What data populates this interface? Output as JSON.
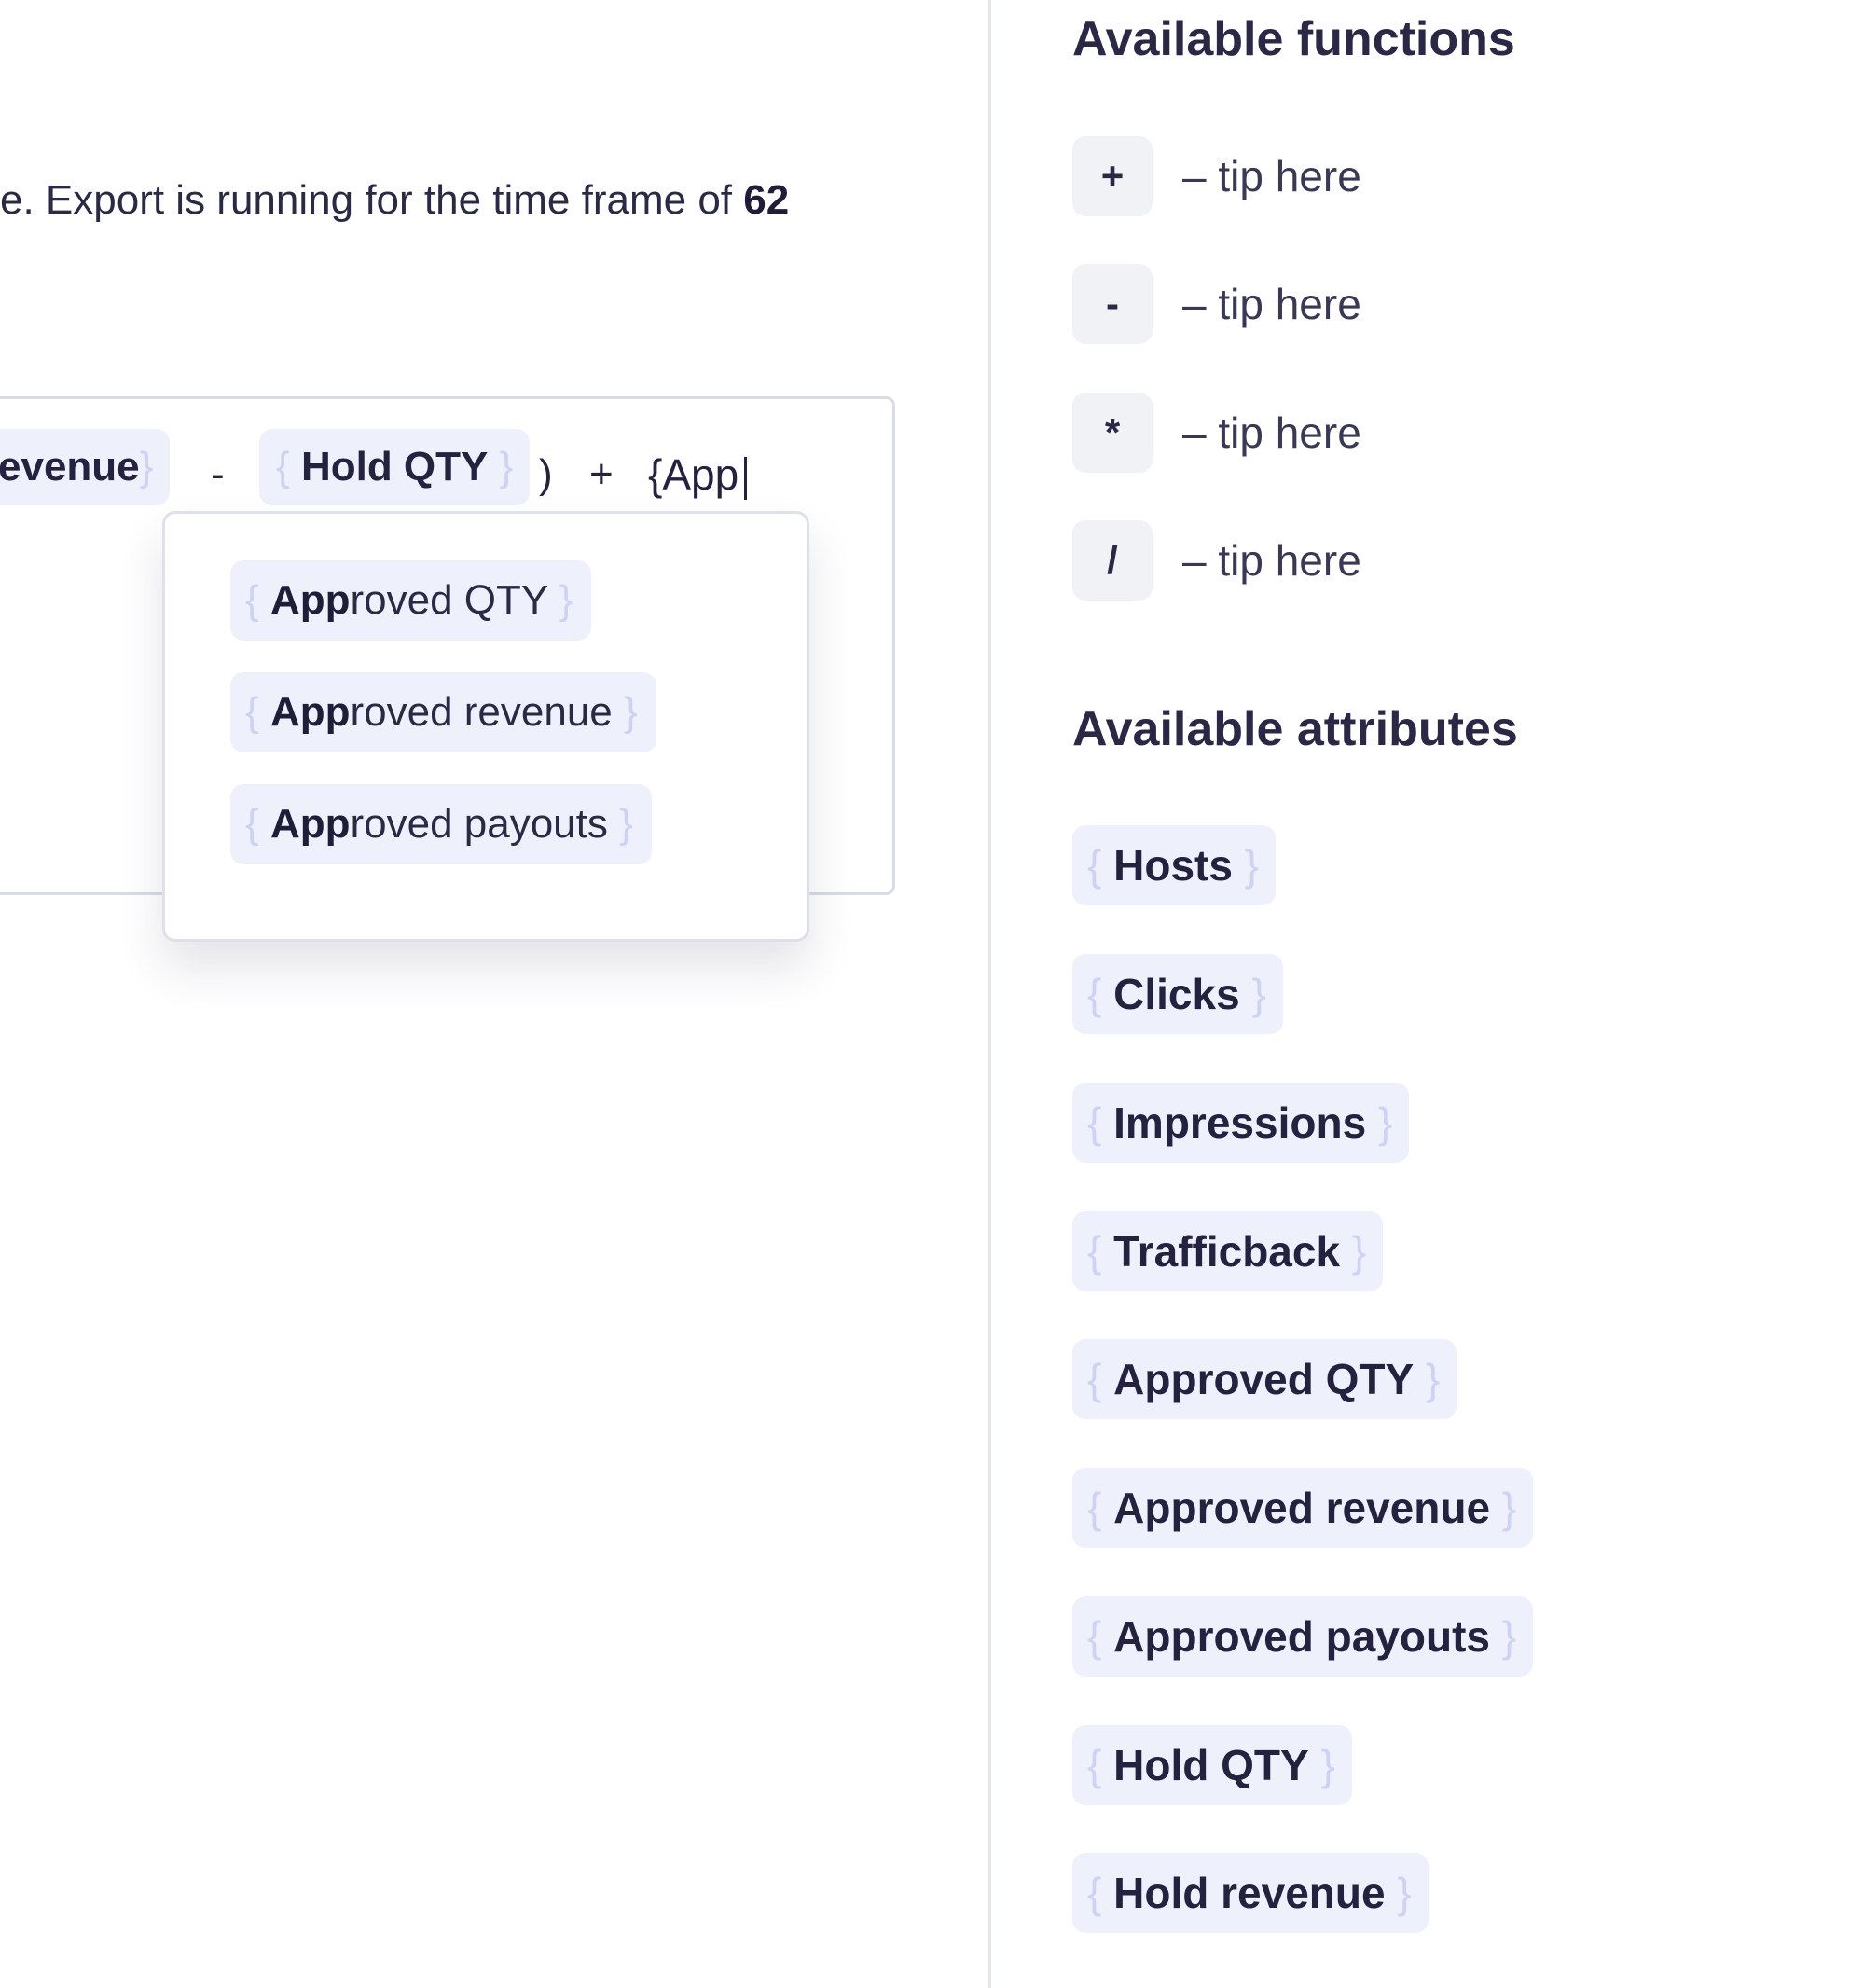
{
  "description": {
    "prefix": "e. Export is running for the time frame of ",
    "days_bold": "62"
  },
  "formula": {
    "chip_revenue": "evenue",
    "op_minus": "-",
    "chip_hold_qty": "Hold QTY",
    "close_paren": ")",
    "op_plus": "+",
    "typed_text": "{App",
    "brace_open": "{",
    "brace_close": "}"
  },
  "suggestions": {
    "query": "App",
    "items": [
      {
        "match": "App",
        "rest": "roved QTY"
      },
      {
        "match": "App",
        "rest": "roved revenue"
      },
      {
        "match": "App",
        "rest": "roved payouts"
      }
    ]
  },
  "functions": {
    "heading": "Available functions",
    "items": [
      {
        "key": "+",
        "tip": "–  tip here"
      },
      {
        "key": "-",
        "tip": "–  tip here"
      },
      {
        "key": "*",
        "tip": "–  tip here"
      },
      {
        "key": "/",
        "tip": "–  tip here"
      }
    ]
  },
  "attributes": {
    "heading": "Available attributes",
    "items": [
      "Hosts",
      "Clicks",
      "Impressions",
      "Trafficback",
      "Approved QTY",
      "Approved revenue",
      "Approved payouts",
      "Hold QTY",
      "Hold revenue"
    ]
  }
}
